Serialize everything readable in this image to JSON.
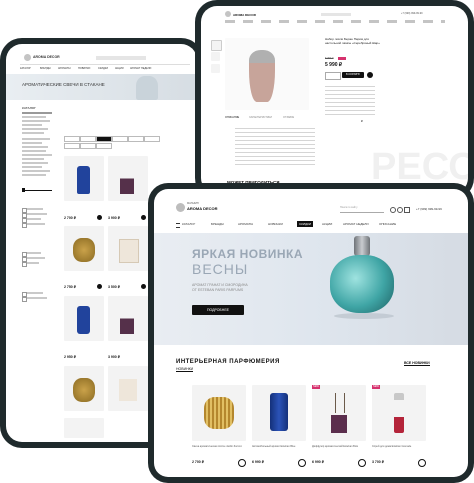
{
  "brand": {
    "name": "AROMA DECOR",
    "tagline": "МАГАЗИН"
  },
  "back_tablet": {
    "nav": [
      "КАТАЛОГ",
      "БРЕНДЫ",
      "АРОМАТЫ",
      "НОВИНКИ",
      "СКИДКИ",
      "АКЦИИ",
      "АРОМАТ НЕДЕЛИ",
      "ОПИСАНИЕ"
    ],
    "banner_title": "АРОМАТИЧЕСКИЕ СВЕЧИ В СТАКАНЕ",
    "sidebar_title": "КАТАЛОГ",
    "prices": [
      "2 700 ₽",
      "3 900 ₽",
      "2 750 ₽",
      "3 500 ₽",
      "2 950 ₽",
      "3 900 ₽"
    ]
  },
  "top_tablet": {
    "product_title": "Набор ловли Берже Париж для настольной лампы «Серебряный Шар»",
    "price": "5 990 ₽",
    "old_price": "8 750 ₽",
    "add_to_cart": "В КОРЗИНУ",
    "buy_one_click": "КУПИТЬ",
    "section_title": "МОЖЕТ ПРИГОДИТЬСЯ",
    "tabs": [
      "ОПИСАНИЕ",
      "ХАРАКТЕРИСТИКИ",
      "ОТЗЫВЫ"
    ],
    "phone": "+7 (999) 999-99-99"
  },
  "front_tablet": {
    "search_placeholder": "Поиск по сайту",
    "phone": "+7 (999) 999-99-99",
    "nav": [
      "КАТАЛОГ",
      "БРЕНДЫ",
      "АРОМАТЫ",
      "НОВИНКИ",
      "СКИДКИ",
      "АКЦИИ",
      "АРОМАТ НЕДЕЛИ",
      "ОПИСАНИЕ"
    ],
    "nav_active_index": 4,
    "hero": {
      "title_line1": "ЯРКАЯ НОВИНКА",
      "title_line2": "ВЕСНЫ",
      "subtitle_line1": "АРОМАТ ГРАНАТ И СМОРОДИНА",
      "subtitle_line2": "ОТ ESTEBAN PARIS PARFUMS",
      "button": "ПОДРОБНЕЕ"
    },
    "section_title": "ИНТЕРЬЕРНАЯ ПАРФЮМЕРИЯ",
    "section_tab": "НОВИНКИ",
    "all_link": "ВСЕ НОВИНКИ",
    "products": [
      {
        "title": "Свеча ароматическая Arome Jardin Золото",
        "price": "2 700 ₽",
        "badge": ""
      },
      {
        "title": "Автомобильный аромат Esteban Blue",
        "price": "6 990 ₽",
        "badge": ""
      },
      {
        "title": "Диффузор ароматический Esteban Bois",
        "price": "6 990 ₽",
        "badge": "NEW"
      },
      {
        "title": "Спрей для дома Esteban Grenade",
        "price": "3 700 ₽",
        "badge": "NEW"
      }
    ],
    "colors": {
      "accent": "#d6326e",
      "dark": "#1f2a2c",
      "hero_bg": "#dfe6ee"
    }
  }
}
